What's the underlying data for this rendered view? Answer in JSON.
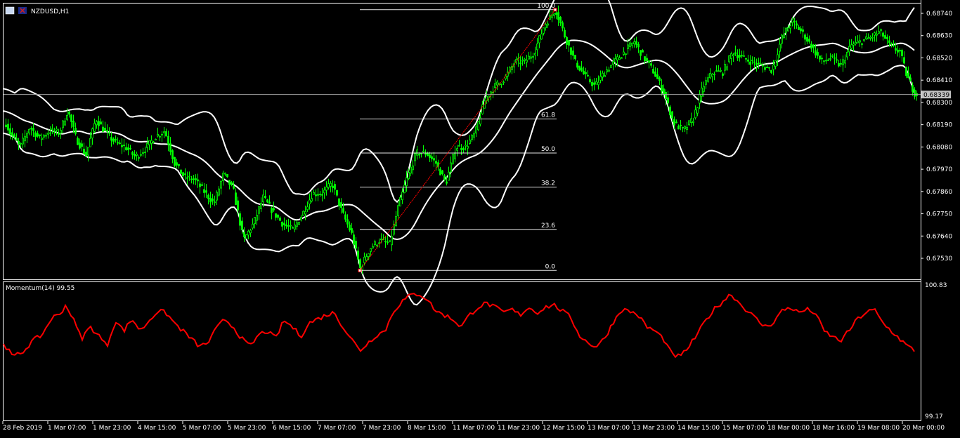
{
  "window": {
    "title": "NZDUSD,H1",
    "icon": "chart-window-icon",
    "flag_icon": "nz-flag-icon"
  },
  "price_axis": {
    "labels": [
      "0.68740",
      "0.68630",
      "0.68520",
      "0.68410",
      "0.68300",
      "0.68190",
      "0.68080",
      "0.67970",
      "0.67860",
      "0.67750",
      "0.67640",
      "0.67530"
    ],
    "current_price": "0.68339"
  },
  "indicator": {
    "label": "Momentum(14) 99.55",
    "axis_top": "100.83",
    "axis_bottom": "99.17",
    "color": "#ff0000"
  },
  "fibonacci": {
    "levels": [
      {
        "label": "100.0",
        "price": 0.68758
      },
      {
        "label": "61.8",
        "price": 0.68218
      },
      {
        "label": "50.0",
        "price": 0.6805
      },
      {
        "label": "38.2",
        "price": 0.67882
      },
      {
        "label": "23.6",
        "price": 0.67673
      },
      {
        "label": "0.0",
        "price": 0.6747
      }
    ],
    "color": "#ff0000"
  },
  "time_axis": {
    "labels": [
      "28 Feb 2019",
      "1 Mar 07:00",
      "1 Mar 23:00",
      "4 Mar 15:00",
      "5 Mar 07:00",
      "5 Mar 23:00",
      "6 Mar 15:00",
      "7 Mar 07:00",
      "7 Mar 23:00",
      "8 Mar 15:00",
      "11 Mar 07:00",
      "11 Mar 23:00",
      "12 Mar 15:00",
      "13 Mar 07:00",
      "13 Mar 23:00",
      "14 Mar 15:00",
      "15 Mar 07:00",
      "18 Mar 00:00",
      "18 Mar 16:00",
      "19 Mar 08:00",
      "20 Mar 00:00"
    ]
  },
  "chart_data": {
    "type": "line",
    "symbol": "NZDUSD",
    "timeframe": "H1",
    "candle_color": "#00ff00",
    "ylim": [
      0.6748,
      0.688
    ],
    "close_path": [
      [
        0,
        0.6826
      ],
      [
        14,
        0.6815
      ],
      [
        28,
        0.6808
      ],
      [
        42,
        0.6818
      ],
      [
        56,
        0.6812
      ],
      [
        70,
        0.6816
      ],
      [
        84,
        0.6815
      ],
      [
        96,
        0.6826
      ],
      [
        108,
        0.6812
      ],
      [
        122,
        0.6804
      ],
      [
        136,
        0.6822
      ],
      [
        150,
        0.6815
      ],
      [
        164,
        0.681
      ],
      [
        178,
        0.6808
      ],
      [
        192,
        0.6803
      ],
      [
        206,
        0.6807
      ],
      [
        220,
        0.6813
      ],
      [
        234,
        0.6816
      ],
      [
        248,
        0.68
      ],
      [
        262,
        0.6793
      ],
      [
        276,
        0.6792
      ],
      [
        290,
        0.6786
      ],
      [
        304,
        0.678
      ],
      [
        318,
        0.6795
      ],
      [
        332,
        0.6786
      ],
      [
        346,
        0.6762
      ],
      [
        360,
        0.677
      ],
      [
        374,
        0.6783
      ],
      [
        388,
        0.6776
      ],
      [
        402,
        0.677
      ],
      [
        416,
        0.6767
      ],
      [
        430,
        0.6775
      ],
      [
        444,
        0.6785
      ],
      [
        458,
        0.6785
      ],
      [
        472,
        0.679
      ],
      [
        486,
        0.6776
      ],
      [
        500,
        0.6765
      ],
      [
        512,
        0.6748
      ],
      [
        526,
        0.6758
      ],
      [
        540,
        0.6762
      ],
      [
        554,
        0.676
      ],
      [
        566,
        0.6778
      ],
      [
        578,
        0.6792
      ],
      [
        592,
        0.6805
      ],
      [
        606,
        0.6805
      ],
      [
        620,
        0.68
      ],
      [
        634,
        0.679
      ],
      [
        648,
        0.6808
      ],
      [
        662,
        0.6808
      ],
      [
        676,
        0.6815
      ],
      [
        690,
        0.6832
      ],
      [
        704,
        0.6838
      ],
      [
        718,
        0.6842
      ],
      [
        732,
        0.685
      ],
      [
        746,
        0.685
      ],
      [
        760,
        0.6855
      ],
      [
        774,
        0.6868
      ],
      [
        790,
        0.6876
      ],
      [
        804,
        0.6862
      ],
      [
        818,
        0.685
      ],
      [
        832,
        0.6843
      ],
      [
        846,
        0.6838
      ],
      [
        860,
        0.6845
      ],
      [
        874,
        0.685
      ],
      [
        888,
        0.6855
      ],
      [
        902,
        0.686
      ],
      [
        916,
        0.6852
      ],
      [
        930,
        0.6845
      ],
      [
        944,
        0.6835
      ],
      [
        958,
        0.682
      ],
      [
        972,
        0.6816
      ],
      [
        986,
        0.6822
      ],
      [
        1000,
        0.6838
      ],
      [
        1014,
        0.6845
      ],
      [
        1028,
        0.6845
      ],
      [
        1042,
        0.6855
      ],
      [
        1056,
        0.6852
      ],
      [
        1070,
        0.685
      ],
      [
        1084,
        0.6848
      ],
      [
        1098,
        0.6846
      ],
      [
        1112,
        0.6862
      ],
      [
        1126,
        0.687
      ],
      [
        1140,
        0.6865
      ],
      [
        1154,
        0.6858
      ],
      [
        1168,
        0.685
      ],
      [
        1182,
        0.6852
      ],
      [
        1196,
        0.6848
      ],
      [
        1210,
        0.6858
      ],
      [
        1224,
        0.686
      ],
      [
        1238,
        0.6862
      ],
      [
        1252,
        0.6865
      ],
      [
        1266,
        0.6858
      ],
      [
        1280,
        0.6855
      ],
      [
        1290,
        0.6843
      ],
      [
        1302,
        0.6834
      ]
    ],
    "momentum_path": [
      [
        5,
        100.1
      ],
      [
        18,
        99.92
      ],
      [
        32,
        99.98
      ],
      [
        46,
        100.12
      ],
      [
        60,
        100.2
      ],
      [
        74,
        100.42
      ],
      [
        84,
        100.45
      ],
      [
        94,
        100.58
      ],
      [
        104,
        100.4
      ],
      [
        116,
        100.15
      ],
      [
        128,
        100.3
      ],
      [
        140,
        100.2
      ],
      [
        152,
        100.05
      ],
      [
        164,
        100.38
      ],
      [
        176,
        100.25
      ],
      [
        188,
        100.4
      ],
      [
        200,
        100.25
      ],
      [
        212,
        100.38
      ],
      [
        224,
        100.5
      ],
      [
        236,
        100.48
      ],
      [
        248,
        100.35
      ],
      [
        260,
        100.25
      ],
      [
        272,
        100.15
      ],
      [
        284,
        100.05
      ],
      [
        296,
        100.1
      ],
      [
        308,
        100.28
      ],
      [
        320,
        100.4
      ],
      [
        332,
        100.3
      ],
      [
        344,
        100.15
      ],
      [
        356,
        100.05
      ],
      [
        368,
        100.2
      ],
      [
        380,
        100.25
      ],
      [
        392,
        100.15
      ],
      [
        404,
        100.38
      ],
      [
        416,
        100.3
      ],
      [
        428,
        100.18
      ],
      [
        440,
        100.35
      ],
      [
        452,
        100.4
      ],
      [
        464,
        100.45
      ],
      [
        476,
        100.48
      ],
      [
        488,
        100.3
      ],
      [
        500,
        100.15
      ],
      [
        512,
        100.0
      ],
      [
        524,
        100.1
      ],
      [
        536,
        100.2
      ],
      [
        548,
        100.25
      ],
      [
        560,
        100.5
      ],
      [
        572,
        100.62
      ],
      [
        584,
        100.7
      ],
      [
        596,
        100.72
      ],
      [
        608,
        100.65
      ],
      [
        620,
        100.5
      ],
      [
        632,
        100.45
      ],
      [
        644,
        100.4
      ],
      [
        656,
        100.3
      ],
      [
        668,
        100.45
      ],
      [
        680,
        100.55
      ],
      [
        692,
        100.6
      ],
      [
        704,
        100.55
      ],
      [
        716,
        100.48
      ],
      [
        728,
        100.52
      ],
      [
        740,
        100.45
      ],
      [
        752,
        100.55
      ],
      [
        764,
        100.48
      ],
      [
        776,
        100.55
      ],
      [
        788,
        100.58
      ],
      [
        800,
        100.5
      ],
      [
        812,
        100.42
      ],
      [
        824,
        100.2
      ],
      [
        836,
        100.1
      ],
      [
        848,
        100.05
      ],
      [
        860,
        100.15
      ],
      [
        872,
        100.35
      ],
      [
        884,
        100.52
      ],
      [
        896,
        100.5
      ],
      [
        908,
        100.45
      ],
      [
        920,
        100.3
      ],
      [
        932,
        100.25
      ],
      [
        944,
        100.15
      ],
      [
        956,
        99.95
      ],
      [
        968,
        99.92
      ],
      [
        980,
        100.05
      ],
      [
        992,
        100.2
      ],
      [
        1004,
        100.38
      ],
      [
        1016,
        100.52
      ],
      [
        1028,
        100.62
      ],
      [
        1040,
        100.72
      ],
      [
        1052,
        100.6
      ],
      [
        1064,
        100.5
      ],
      [
        1076,
        100.4
      ],
      [
        1088,
        100.3
      ],
      [
        1100,
        100.35
      ],
      [
        1112,
        100.5
      ],
      [
        1124,
        100.55
      ],
      [
        1136,
        100.48
      ],
      [
        1148,
        100.52
      ],
      [
        1160,
        100.48
      ],
      [
        1172,
        100.25
      ],
      [
        1184,
        100.18
      ],
      [
        1196,
        100.12
      ],
      [
        1208,
        100.25
      ],
      [
        1220,
        100.4
      ],
      [
        1232,
        100.48
      ],
      [
        1244,
        100.52
      ],
      [
        1256,
        100.35
      ],
      [
        1268,
        100.25
      ],
      [
        1280,
        100.15
      ],
      [
        1292,
        100.05
      ],
      [
        1302,
        100.0
      ]
    ]
  }
}
